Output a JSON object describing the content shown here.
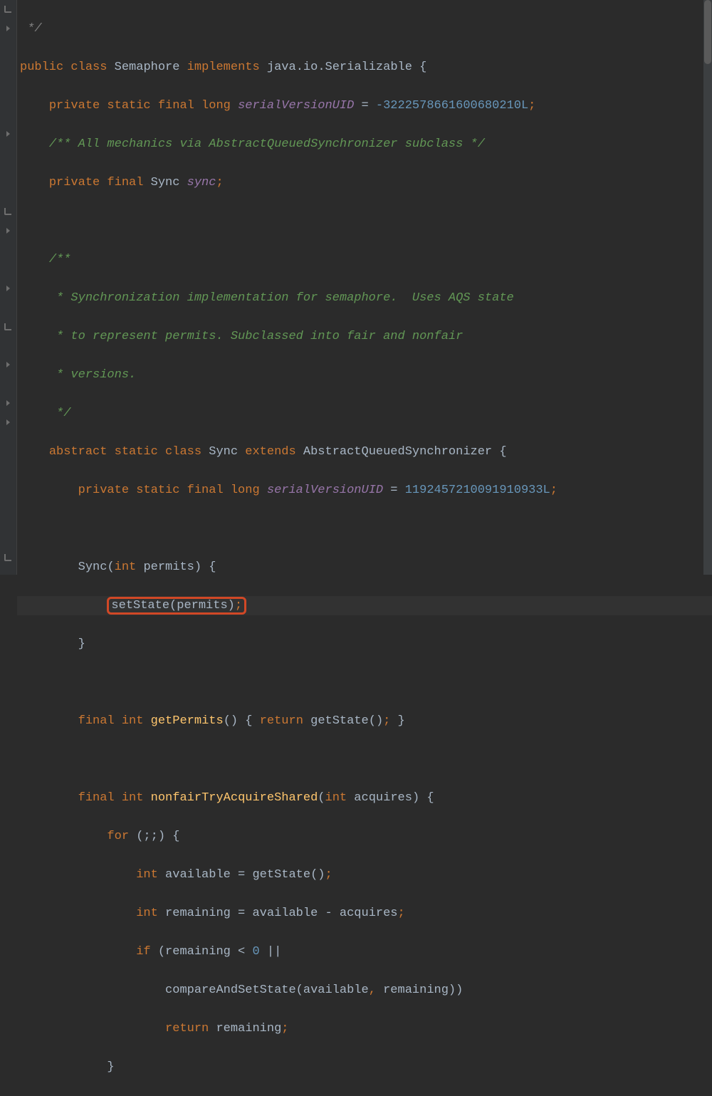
{
  "lines": {
    "l0a": " ",
    "l0b": "*/",
    "l1_kw1": "public",
    "l1_kw2": "class",
    "l1_cl": "Semaphore",
    "l1_kw3": "implements",
    "l1_iface": "java.io.Serializable",
    "l1_brace": " {",
    "l2_kw": "private static final long ",
    "l2_field": "serialVersionUID",
    "l2_eq": " = ",
    "l2_num": "-3222578661600680210L",
    "l2_semi": ";",
    "l3": "/** All mechanics via AbstractQueuedSynchronizer subclass */",
    "l4_kw": "private final ",
    "l4_type": "Sync ",
    "l4_field": "sync",
    "l4_semi": ";",
    "l6": "/**",
    "l7": " * Synchronization implementation for semaphore.  Uses AQS state",
    "l8": " * to represent permits. Subclassed into fair and nonfair",
    "l9": " * versions.",
    "l10": " */",
    "l11_kw": "abstract static class ",
    "l11_cl": "Sync ",
    "l11_kw2": "extends ",
    "l11_sup": "AbstractQueuedSynchronizer",
    "l11_brace": " {",
    "l12_kw": "private static final long ",
    "l12_field": "serialVersionUID",
    "l12_eq": " = ",
    "l12_num": "1192457210091910933L",
    "l12_semi": ";",
    "l14_ctor": "Sync",
    "l14_p1": "(",
    "l14_kw": "int",
    "l14_param": " permits",
    "l14_p2": ") {",
    "l15_call": "setState(permits)",
    "l15_semi": ";",
    "l16": "}",
    "l18_kw": "final int ",
    "l18_m": "getPermits",
    "l18_rest": "() { ",
    "l18_kw2": "return",
    "l18_call": " getState()",
    "l18_semi": ";",
    "l18_close": " }",
    "l20_kw": "final int ",
    "l20_m": "nonfairTryAcquireShared",
    "l20_p1": "(",
    "l20_kw2": "int",
    "l20_param": " acquires",
    "l20_p2": ") {",
    "l21_kw": "for",
    "l21_rest": " (;;) {",
    "l22_kw": "int",
    "l22_rest": " available = getState()",
    "l22_semi": ";",
    "l23_kw": "int",
    "l23_rest": " remaining = available - acquires",
    "l23_semi": ";",
    "l24_kw": "if",
    "l24_rest": " (remaining < ",
    "l24_num": "0",
    "l24_or": " ||",
    "l25": "compareAndSetState(available",
    "l25_comma": ",",
    "l25_rest": " remaining))",
    "l26_kw": "return",
    "l26_rest": " remaining",
    "l26_semi": ";",
    "l27": "}"
  }
}
